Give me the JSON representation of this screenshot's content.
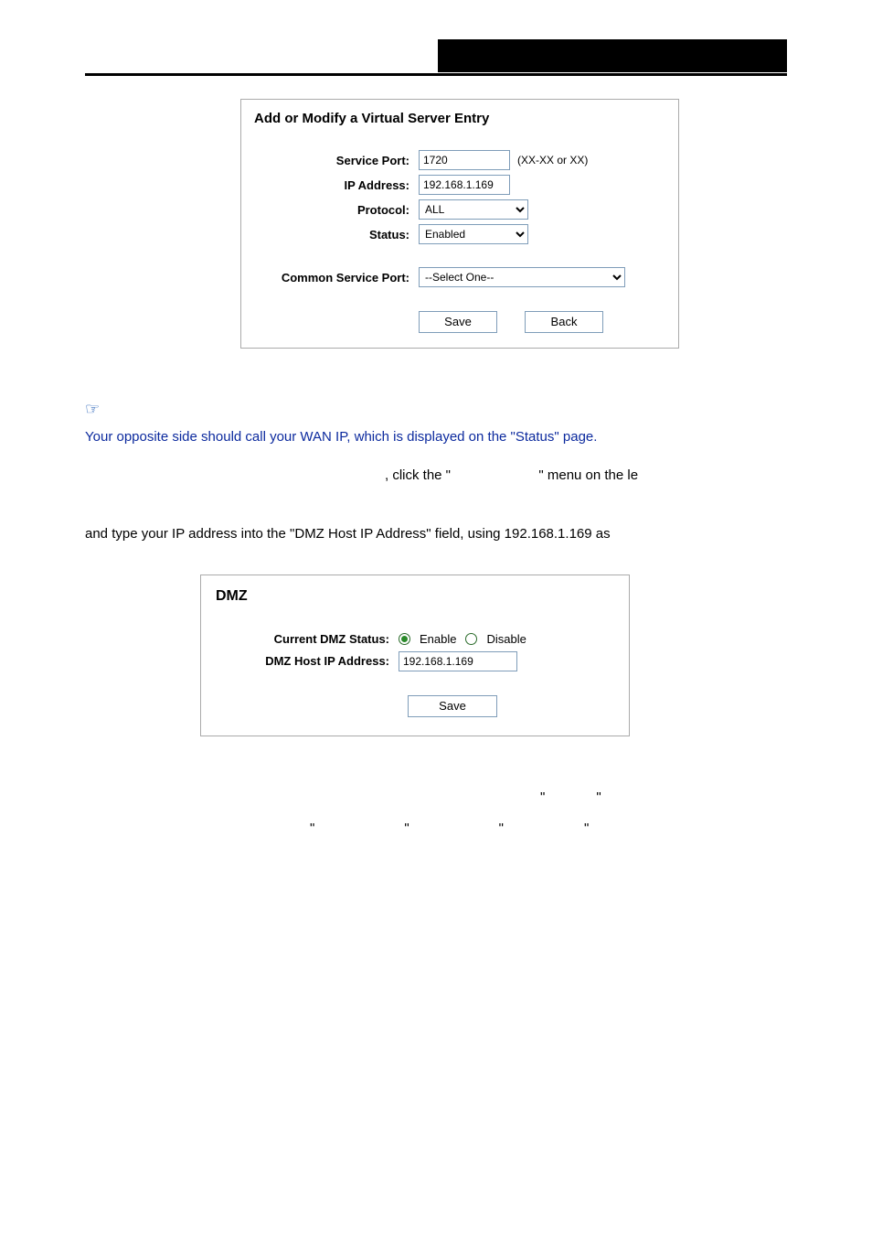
{
  "virtualServer": {
    "title": "Add or Modify a Virtual Server Entry",
    "labels": {
      "servicePort": "Service Port:",
      "ipAddress": "IP Address:",
      "protocol": "Protocol:",
      "status": "Status:",
      "commonServicePort": "Common Service Port:"
    },
    "values": {
      "servicePort": "1720",
      "ipAddress": "192.168.1.169",
      "protocol": "ALL",
      "status": "Enabled",
      "commonServicePort": "--Select One--"
    },
    "hint": "(XX-XX or XX)",
    "buttons": {
      "save": "Save",
      "back": "Back"
    }
  },
  "note": {
    "text": "Your opposite side should call your WAN IP, which is displayed on the \"Status\" page."
  },
  "bodyLine1a": ", click the \"",
  "bodyLine1b": "\" menu on the le",
  "bodyLine2": "and type your IP address into the \"DMZ Host IP Address\" field, using 192.168.1.169 as",
  "dmz": {
    "title": "DMZ",
    "labels": {
      "status": "Current DMZ Status:",
      "hostIp": "DMZ Host IP Address:"
    },
    "options": {
      "enable": "Enable",
      "disable": "Disable"
    },
    "values": {
      "hostIp": "192.168.1.169"
    },
    "buttons": {
      "save": "Save"
    }
  },
  "quotes": {
    "q1": "\"",
    "q2": "\"",
    "q3": "\"",
    "q4": "\"",
    "q5": "\"",
    "q6": "\""
  }
}
